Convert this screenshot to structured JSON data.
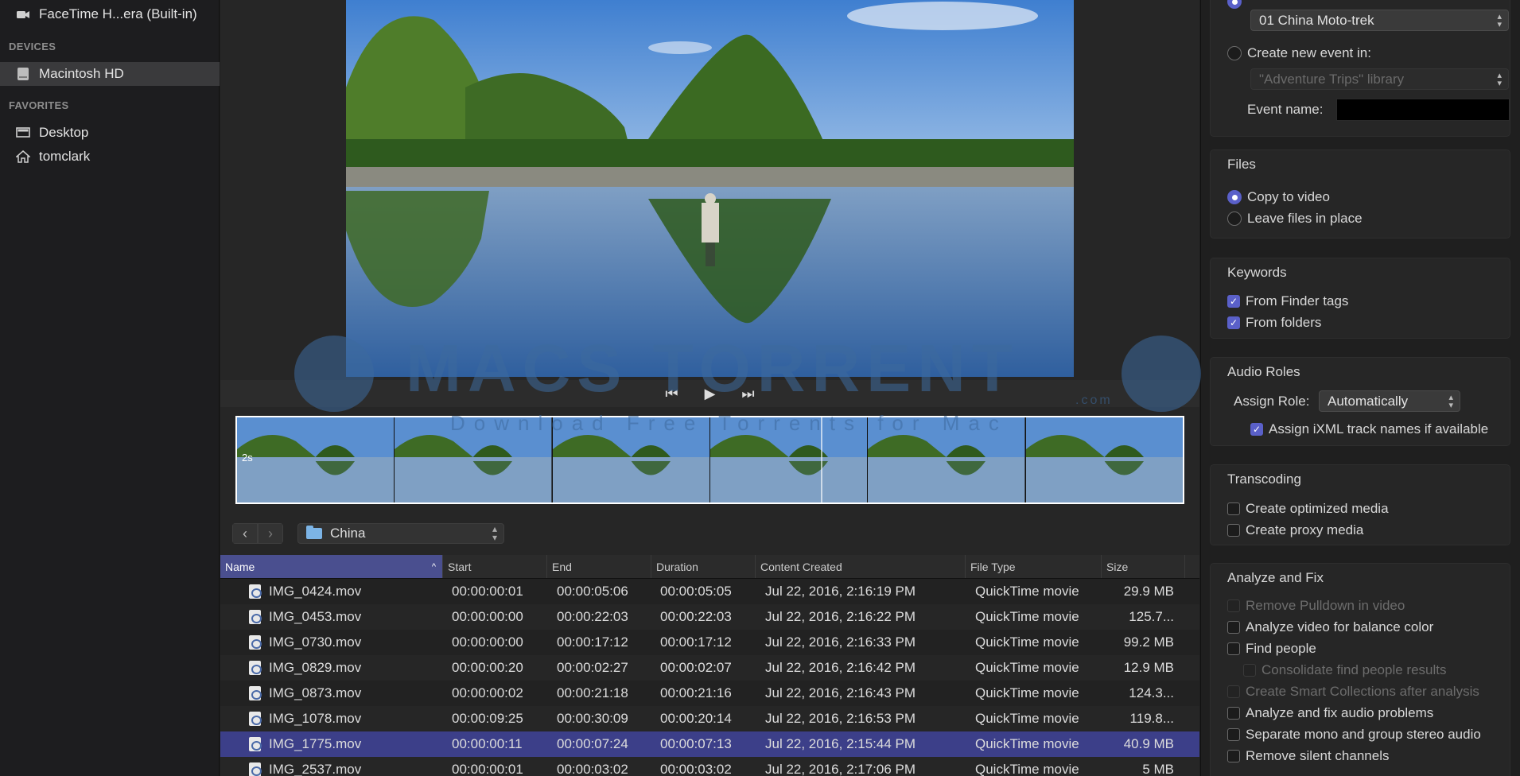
{
  "sidebar": {
    "camera_item": "FaceTime H...era (Built-in)",
    "devices_header": "DEVICES",
    "device_item": "Macintosh HD",
    "favorites_header": "FAVORITES",
    "favorites": [
      "Desktop",
      "tomclark"
    ]
  },
  "viewer": {
    "filmstrip_scale": "2s"
  },
  "browser": {
    "folder": "China"
  },
  "table": {
    "columns": [
      "Name",
      "Start",
      "End",
      "Duration",
      "Content Created",
      "File Type",
      "Size"
    ],
    "rows": [
      {
        "name": "IMG_0424.mov",
        "start": "00:00:00:01",
        "end": "00:00:05:06",
        "duration": "00:00:05:05",
        "created": "Jul 22, 2016, 2:16:19 PM",
        "type": "QuickTime movie",
        "size": "29.9 MB"
      },
      {
        "name": "IMG_0453.mov",
        "start": "00:00:00:00",
        "end": "00:00:22:03",
        "duration": "00:00:22:03",
        "created": "Jul 22, 2016, 2:16:22 PM",
        "type": "QuickTime movie",
        "size": "125.7..."
      },
      {
        "name": "IMG_0730.mov",
        "start": "00:00:00:00",
        "end": "00:00:17:12",
        "duration": "00:00:17:12",
        "created": "Jul 22, 2016, 2:16:33 PM",
        "type": "QuickTime movie",
        "size": "99.2 MB"
      },
      {
        "name": "IMG_0829.mov",
        "start": "00:00:00:20",
        "end": "00:00:02:27",
        "duration": "00:00:02:07",
        "created": "Jul 22, 2016, 2:16:42 PM",
        "type": "QuickTime movie",
        "size": "12.9 MB"
      },
      {
        "name": "IMG_0873.mov",
        "start": "00:00:00:02",
        "end": "00:00:21:18",
        "duration": "00:00:21:16",
        "created": "Jul 22, 2016, 2:16:43 PM",
        "type": "QuickTime movie",
        "size": "124.3..."
      },
      {
        "name": "IMG_1078.mov",
        "start": "00:00:09:25",
        "end": "00:00:30:09",
        "duration": "00:00:20:14",
        "created": "Jul 22, 2016, 2:16:53 PM",
        "type": "QuickTime movie",
        "size": "119.8..."
      },
      {
        "name": "IMG_1775.mov",
        "start": "00:00:00:11",
        "end": "00:00:07:24",
        "duration": "00:00:07:13",
        "created": "Jul 22, 2016, 2:15:44 PM",
        "type": "QuickTime movie",
        "size": "40.9 MB"
      },
      {
        "name": "IMG_2537.mov",
        "start": "00:00:00:01",
        "end": "00:00:03:02",
        "duration": "00:00:03:02",
        "created": "Jul 22, 2016, 2:17:06 PM",
        "type": "QuickTime movie",
        "size": "5 MB"
      }
    ],
    "selected_index": 6
  },
  "right": {
    "existing_event": "01 China Moto-trek",
    "create_new_label": "Create new event in:",
    "library_placeholder": "\"Adventure Trips\" library",
    "event_name_label": "Event name:",
    "files": {
      "title": "Files",
      "copy": "Copy to video",
      "leave": "Leave files in place"
    },
    "keywords": {
      "title": "Keywords",
      "finder_tags": "From Finder tags",
      "folders": "From folders"
    },
    "audio": {
      "title": "Audio Roles",
      "assign_label": "Assign Role:",
      "assign_value": "Automatically",
      "ixml": "Assign iXML track names if available"
    },
    "transcoding": {
      "title": "Transcoding",
      "optimized": "Create optimized media",
      "proxy": "Create proxy media"
    },
    "analyze": {
      "title": "Analyze and Fix",
      "items": [
        "Remove Pulldown in video",
        "Analyze video for balance color",
        "Find people",
        "Consolidate find people results",
        "Create Smart Collections after analysis",
        "Analyze and fix audio problems",
        "Separate mono and group stereo audio",
        "Remove silent channels"
      ]
    }
  },
  "watermark": {
    "main": "MACS TORRENT",
    "sub": "Download Free Torrents for Mac",
    "dot": ".com"
  }
}
